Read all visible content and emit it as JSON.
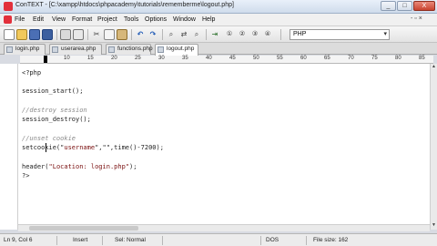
{
  "window": {
    "title": "ConTEXT - [C:\\xampp\\htdocs\\phpacademy\\tutorials\\rememberme\\logout.php]",
    "min": "_",
    "max": "□",
    "close": "X"
  },
  "menu": {
    "items": [
      "File",
      "Edit",
      "View",
      "Format",
      "Project",
      "Tools",
      "Options",
      "Window",
      "Help"
    ],
    "doc_controls": "- ▫ ×"
  },
  "toolbar": {
    "language": "PHP",
    "icons": [
      "new-file-icon",
      "open-file-icon",
      "save-icon",
      "save-all-icon",
      "print-icon",
      "print-preview-icon",
      "cut-icon",
      "copy-icon",
      "paste-icon",
      "undo-icon",
      "redo-icon",
      "find-icon",
      "replace-icon",
      "indent-icon",
      "user-command-1-icon",
      "user-command-2-icon",
      "user-command-3-icon",
      "user-command-4-icon"
    ]
  },
  "tabs": [
    {
      "label": "login.php",
      "active": false
    },
    {
      "label": "userarea.php",
      "active": false
    },
    {
      "label": "functions.php",
      "active": false
    },
    {
      "label": "logout.php",
      "active": true
    }
  ],
  "ruler": {
    "marks": [
      "10",
      "15",
      "20",
      "25",
      "30",
      "35",
      "40",
      "45",
      "50",
      "55",
      "60",
      "65",
      "70",
      "75",
      "80",
      "85",
      "90"
    ]
  },
  "code": {
    "line1": "<?php",
    "line3": "session_start();",
    "line5": "//destroy session",
    "line6": "session_destroy();",
    "line8": "//unset cookie",
    "line9_a": "setcookie(\"",
    "line9_b": "username",
    "line9_c": "\",\"\",time()-7200);",
    "line11_a": "header(",
    "line11_b": "\"Location: login.php\"",
    "line11_c": ");",
    "line12": "?>"
  },
  "status": {
    "position": "Ln 9, Col 6",
    "mode": "Insert",
    "selection": "Sel: Normal",
    "format": "DOS",
    "filesize": "File size: 162"
  }
}
